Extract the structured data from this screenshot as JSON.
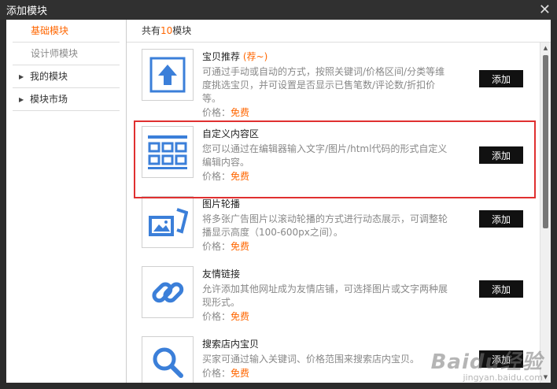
{
  "dialog": {
    "title": "添加模块"
  },
  "sidebar": {
    "items": [
      {
        "label": "基础模块"
      },
      {
        "label": "设计师模块"
      },
      {
        "label": "我的模块"
      },
      {
        "label": "模块市场"
      }
    ]
  },
  "main": {
    "header_prefix": "共有",
    "header_count": "10",
    "header_suffix": "模块",
    "price_label": "价格：",
    "price_free": "免费",
    "add_label": "添加",
    "modules": [
      {
        "title": "宝贝推荐",
        "tag": "(荐~)",
        "desc": "可通过手动或自动的方式，按照关键词/价格区间/分类等维度挑选宝贝，并可设置是否显示已售笔数/评论数/折扣价等。",
        "icon": "upload-arrow-icon"
      },
      {
        "title": "自定义内容区",
        "tag": "",
        "desc": "您可以通过在编辑器输入文字/图片/html代码的形式自定义编辑内容。",
        "icon": "grid-layout-icon"
      },
      {
        "title": "图片轮播",
        "tag": "",
        "desc": "将多张广告图片以滚动轮播的方式进行动态展示，可调整轮播显示高度（100-600px之间）。",
        "icon": "image-slides-icon"
      },
      {
        "title": "友情链接",
        "tag": "",
        "desc": "允许添加其他网址成为友情店铺，可选择图片或文字两种展现形式。",
        "icon": "chain-link-icon"
      },
      {
        "title": "搜索店内宝贝",
        "tag": "",
        "desc": "买家可通过输入关键词、价格范围来搜索店内宝贝。",
        "icon": "magnifier-icon"
      }
    ]
  },
  "watermark": {
    "logo": "Baidu经验",
    "url": "jingyan.baidu.com"
  },
  "colors": {
    "accent": "#ff6600",
    "icon_blue": "#3b7fd9",
    "highlight": "#e03030",
    "button": "#111111"
  }
}
